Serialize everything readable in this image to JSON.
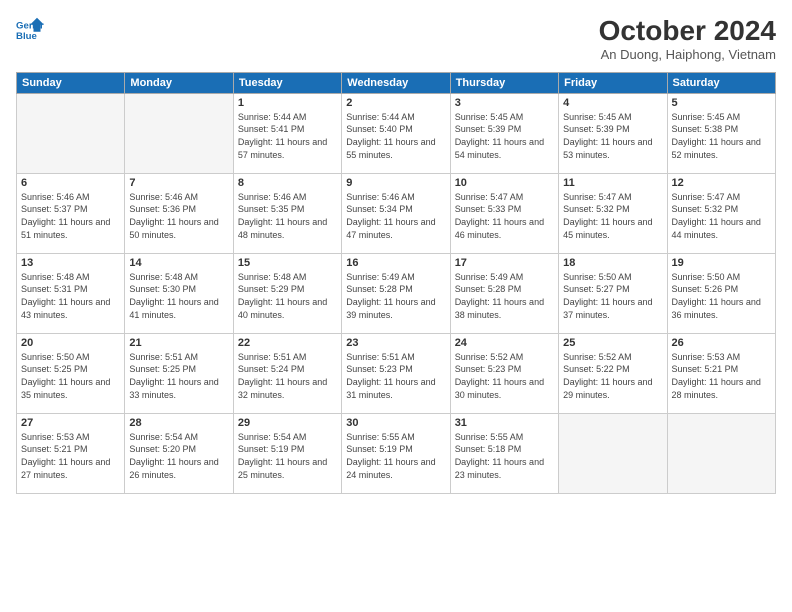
{
  "header": {
    "logo_line1": "General",
    "logo_line2": "Blue",
    "month_title": "October 2024",
    "location": "An Duong, Haiphong, Vietnam"
  },
  "days_of_week": [
    "Sunday",
    "Monday",
    "Tuesday",
    "Wednesday",
    "Thursday",
    "Friday",
    "Saturday"
  ],
  "weeks": [
    [
      {
        "day": "",
        "empty": true
      },
      {
        "day": "",
        "empty": true
      },
      {
        "day": "1",
        "sunrise": "5:44 AM",
        "sunset": "5:41 PM",
        "daylight": "11 hours and 57 minutes."
      },
      {
        "day": "2",
        "sunrise": "5:44 AM",
        "sunset": "5:40 PM",
        "daylight": "11 hours and 55 minutes."
      },
      {
        "day": "3",
        "sunrise": "5:45 AM",
        "sunset": "5:39 PM",
        "daylight": "11 hours and 54 minutes."
      },
      {
        "day": "4",
        "sunrise": "5:45 AM",
        "sunset": "5:39 PM",
        "daylight": "11 hours and 53 minutes."
      },
      {
        "day": "5",
        "sunrise": "5:45 AM",
        "sunset": "5:38 PM",
        "daylight": "11 hours and 52 minutes."
      }
    ],
    [
      {
        "day": "6",
        "sunrise": "5:46 AM",
        "sunset": "5:37 PM",
        "daylight": "11 hours and 51 minutes."
      },
      {
        "day": "7",
        "sunrise": "5:46 AM",
        "sunset": "5:36 PM",
        "daylight": "11 hours and 50 minutes."
      },
      {
        "day": "8",
        "sunrise": "5:46 AM",
        "sunset": "5:35 PM",
        "daylight": "11 hours and 48 minutes."
      },
      {
        "day": "9",
        "sunrise": "5:46 AM",
        "sunset": "5:34 PM",
        "daylight": "11 hours and 47 minutes."
      },
      {
        "day": "10",
        "sunrise": "5:47 AM",
        "sunset": "5:33 PM",
        "daylight": "11 hours and 46 minutes."
      },
      {
        "day": "11",
        "sunrise": "5:47 AM",
        "sunset": "5:32 PM",
        "daylight": "11 hours and 45 minutes."
      },
      {
        "day": "12",
        "sunrise": "5:47 AM",
        "sunset": "5:32 PM",
        "daylight": "11 hours and 44 minutes."
      }
    ],
    [
      {
        "day": "13",
        "sunrise": "5:48 AM",
        "sunset": "5:31 PM",
        "daylight": "11 hours and 43 minutes."
      },
      {
        "day": "14",
        "sunrise": "5:48 AM",
        "sunset": "5:30 PM",
        "daylight": "11 hours and 41 minutes."
      },
      {
        "day": "15",
        "sunrise": "5:48 AM",
        "sunset": "5:29 PM",
        "daylight": "11 hours and 40 minutes."
      },
      {
        "day": "16",
        "sunrise": "5:49 AM",
        "sunset": "5:28 PM",
        "daylight": "11 hours and 39 minutes."
      },
      {
        "day": "17",
        "sunrise": "5:49 AM",
        "sunset": "5:28 PM",
        "daylight": "11 hours and 38 minutes."
      },
      {
        "day": "18",
        "sunrise": "5:50 AM",
        "sunset": "5:27 PM",
        "daylight": "11 hours and 37 minutes."
      },
      {
        "day": "19",
        "sunrise": "5:50 AM",
        "sunset": "5:26 PM",
        "daylight": "11 hours and 36 minutes."
      }
    ],
    [
      {
        "day": "20",
        "sunrise": "5:50 AM",
        "sunset": "5:25 PM",
        "daylight": "11 hours and 35 minutes."
      },
      {
        "day": "21",
        "sunrise": "5:51 AM",
        "sunset": "5:25 PM",
        "daylight": "11 hours and 33 minutes."
      },
      {
        "day": "22",
        "sunrise": "5:51 AM",
        "sunset": "5:24 PM",
        "daylight": "11 hours and 32 minutes."
      },
      {
        "day": "23",
        "sunrise": "5:51 AM",
        "sunset": "5:23 PM",
        "daylight": "11 hours and 31 minutes."
      },
      {
        "day": "24",
        "sunrise": "5:52 AM",
        "sunset": "5:23 PM",
        "daylight": "11 hours and 30 minutes."
      },
      {
        "day": "25",
        "sunrise": "5:52 AM",
        "sunset": "5:22 PM",
        "daylight": "11 hours and 29 minutes."
      },
      {
        "day": "26",
        "sunrise": "5:53 AM",
        "sunset": "5:21 PM",
        "daylight": "11 hours and 28 minutes."
      }
    ],
    [
      {
        "day": "27",
        "sunrise": "5:53 AM",
        "sunset": "5:21 PM",
        "daylight": "11 hours and 27 minutes."
      },
      {
        "day": "28",
        "sunrise": "5:54 AM",
        "sunset": "5:20 PM",
        "daylight": "11 hours and 26 minutes."
      },
      {
        "day": "29",
        "sunrise": "5:54 AM",
        "sunset": "5:19 PM",
        "daylight": "11 hours and 25 minutes."
      },
      {
        "day": "30",
        "sunrise": "5:55 AM",
        "sunset": "5:19 PM",
        "daylight": "11 hours and 24 minutes."
      },
      {
        "day": "31",
        "sunrise": "5:55 AM",
        "sunset": "5:18 PM",
        "daylight": "11 hours and 23 minutes."
      },
      {
        "day": "",
        "empty": true
      },
      {
        "day": "",
        "empty": true
      }
    ]
  ]
}
